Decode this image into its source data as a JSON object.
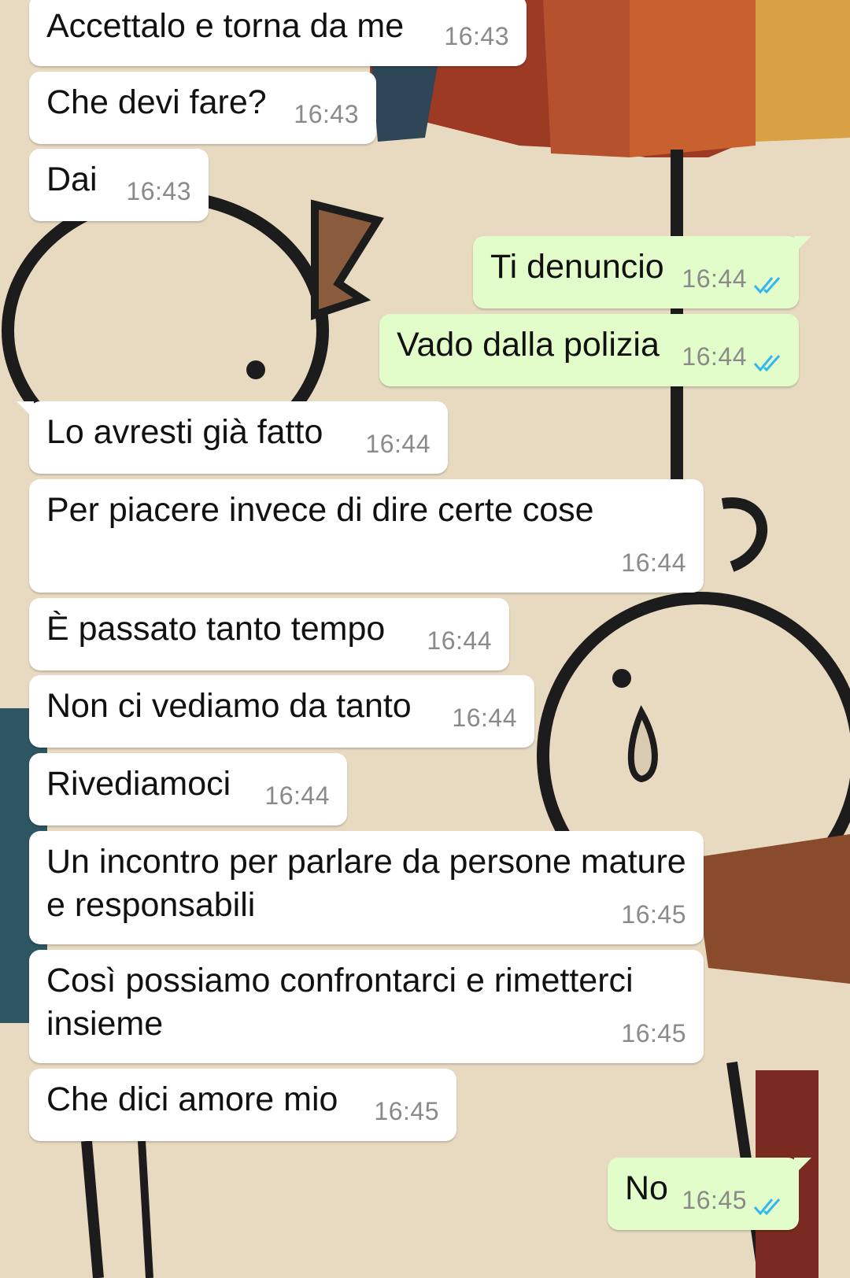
{
  "messages": [
    {
      "dir": "in",
      "text": "Accettalo e torna da me",
      "time": "16:43"
    },
    {
      "dir": "in",
      "text": "Che devi fare?",
      "time": "16:43"
    },
    {
      "dir": "in",
      "text": "Dai",
      "time": "16:43"
    },
    {
      "dir": "out",
      "text": "Ti denuncio",
      "time": "16:44",
      "status": "read"
    },
    {
      "dir": "out",
      "text": "Vado dalla polizia",
      "time": "16:44",
      "status": "read"
    },
    {
      "dir": "in",
      "text": "Lo avresti già fatto",
      "time": "16:44"
    },
    {
      "dir": "in",
      "text": "Per piacere invece di dire certe cose",
      "time": "16:44"
    },
    {
      "dir": "in",
      "text": "È passato tanto tempo",
      "time": "16:44"
    },
    {
      "dir": "in",
      "text": "Non ci vediamo da tanto",
      "time": "16:44"
    },
    {
      "dir": "in",
      "text": "Rivediamoci",
      "time": "16:44"
    },
    {
      "dir": "in",
      "text": "Un incontro per parlare da persone mature e responsabili",
      "time": "16:45"
    },
    {
      "dir": "in",
      "text": "Così possiamo confrontarci e rimetterci insieme",
      "time": "16:45"
    },
    {
      "dir": "in",
      "text": "Che dici amore mio",
      "time": "16:45"
    },
    {
      "dir": "out",
      "text": "No",
      "time": "16:45",
      "status": "read"
    }
  ],
  "colors": {
    "incoming_bubble": "#ffffff",
    "outgoing_bubble": "#e2fdc9",
    "read_receipt": "#34b7f1",
    "timestamp": "#8a8a8a"
  },
  "icons": {
    "read_receipt": "double-check-icon"
  }
}
